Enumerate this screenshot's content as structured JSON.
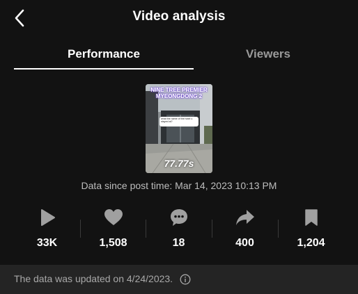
{
  "header": {
    "title": "Video analysis"
  },
  "tabs": [
    {
      "label": "Performance",
      "active": true
    },
    {
      "label": "Viewers",
      "active": false
    }
  ],
  "video": {
    "overlay_title": "NINE TREE PREMIER MYEONGDONG 2",
    "bubble_text": "what the name of the hotel u stayed at?",
    "duration": "77.77s"
  },
  "data_since": "Data since post time: Mar 14, 2023 10:13 PM",
  "stats": [
    {
      "icon": "play-icon",
      "value": "33K"
    },
    {
      "icon": "heart-icon",
      "value": "1,508"
    },
    {
      "icon": "comment-icon",
      "value": "18"
    },
    {
      "icon": "share-icon",
      "value": "400"
    },
    {
      "icon": "bookmark-icon",
      "value": "1,204"
    }
  ],
  "footer": {
    "text": "The data was updated on 4/24/2023."
  },
  "colors": {
    "background": "#121212",
    "footer_background": "#242424",
    "icon_gray": "#a0a0a0"
  }
}
